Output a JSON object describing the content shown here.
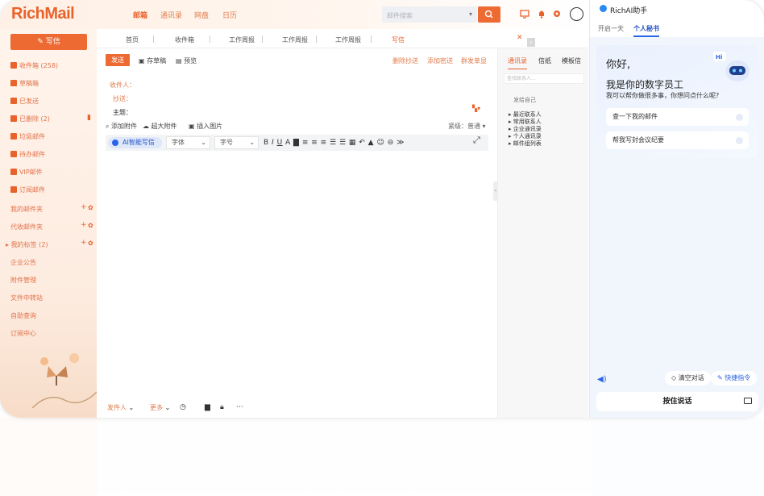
{
  "app": {
    "logo": "RichMail"
  },
  "header": {
    "nav": [
      "邮箱",
      "通讯录",
      "网盘",
      "日历"
    ],
    "search_placeholder": "邮件搜索"
  },
  "sidebar": {
    "compose_label": "写信",
    "items": [
      {
        "label": "收件箱 (258)"
      },
      {
        "label": "草稿箱"
      },
      {
        "label": "已发送"
      },
      {
        "label": "已删除 (2)"
      },
      {
        "label": "垃圾邮件"
      },
      {
        "label": "待办邮件"
      },
      {
        "label": "VIP邮件"
      },
      {
        "label": "订阅邮件"
      }
    ],
    "groups": [
      {
        "label": "我的邮件夹"
      },
      {
        "label": "代收邮件夹"
      },
      {
        "label": "我的标签 (2)"
      }
    ],
    "extra": [
      "企业公告",
      "附件管理",
      "文件中转站",
      "自助查询",
      "订阅中心"
    ]
  },
  "tabs": [
    {
      "label": "首页"
    },
    {
      "label": "收件箱"
    },
    {
      "label": "工作周报"
    },
    {
      "label": "工作周报"
    },
    {
      "label": "工作周报"
    },
    {
      "label": "写信",
      "active": true
    }
  ],
  "compose": {
    "send_label": "发送",
    "save_draft": "存草稿",
    "preview": "预览",
    "delete_cc": "删除抄送",
    "add_bcc": "添加密送",
    "separate_send": "群发单显",
    "to_label": "收件人：",
    "cc_label": "抄送：",
    "subject_label": "主题：",
    "add_attachment": "添加附件",
    "big_attachment": "超大附件",
    "insert_image": "插入图片",
    "priority_label": "紧级：",
    "priority_value": "普通",
    "ai_button": "AI智能写信",
    "font_name": "字体",
    "font_size": "字号",
    "sender_label": "发件人",
    "other_label": "更多"
  },
  "contacts": {
    "tabs": [
      "通讯录",
      "信纸",
      "模板信"
    ],
    "search_placeholder": "查找联系人...",
    "self_label": "发给自己",
    "groups": [
      "最近联系人",
      "常用联系人",
      "企业通讯录",
      "个人通讯录",
      "邮件组列表"
    ]
  },
  "ai_panel": {
    "title": "RichAI助手",
    "tabs": [
      "开启一天",
      "个人秘书"
    ],
    "greeting": "你好,",
    "intro": "我是你的数字员工",
    "sub": "我可以帮你做很多事，你想问点什么呢?",
    "badge": "Hi",
    "suggestions": [
      "查一下我的邮件",
      "帮我写封会议纪要"
    ],
    "clear_chat": "清空对话",
    "quick_cmd": "快捷指令",
    "hold_to_talk": "按住说话"
  }
}
